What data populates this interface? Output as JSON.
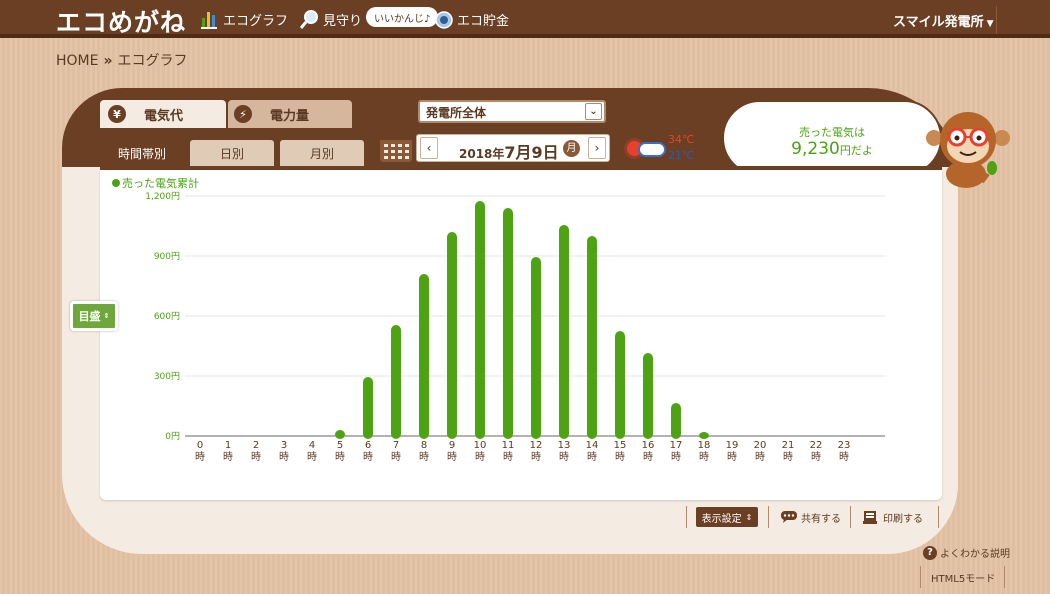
{
  "header": {
    "logo": "エコめがね",
    "nav": [
      {
        "label": "エコグラフ",
        "icon": "bar-chart-icon"
      },
      {
        "label": "見守り",
        "icon": "magnifier-icon"
      },
      {
        "label": "エコ貯金",
        "icon": "coin-icon"
      }
    ],
    "bubble": "いいかんじ♪",
    "user_menu": "スマイル発電所"
  },
  "breadcrumb": {
    "home": "HOME",
    "separator": "»",
    "current": "エコグラフ"
  },
  "tabs": [
    {
      "label": "電気代",
      "icon_glyph": "¥",
      "active": true
    },
    {
      "label": "電力量",
      "icon_glyph": "⚡",
      "active": false
    }
  ],
  "plant_select": {
    "value": "発電所全体"
  },
  "period_tabs": [
    {
      "label": "時間帯別",
      "active": true
    },
    {
      "label": "日別",
      "active": false
    },
    {
      "label": "月別",
      "active": false
    }
  ],
  "date": {
    "year": "2018年",
    "main": "7月9日",
    "weekday": "月",
    "prev": "‹",
    "next": "›"
  },
  "weather": {
    "high": "34℃",
    "low": "21℃"
  },
  "speech": {
    "line1": "売った電気は",
    "amount": "9,230",
    "unit": "円だよ"
  },
  "scale_button": {
    "label": "目盛"
  },
  "bottom": {
    "display_settings": "表示設定",
    "share": "共有する",
    "print": "印刷する",
    "help": "よくわかる説明",
    "html5": "HTML5モード"
  },
  "colors": {
    "brown": "#6b3f23",
    "bar": "#4ea312",
    "accent_green": "#4aa312"
  },
  "chart_data": {
    "type": "bar",
    "legend": "売った電気累計",
    "categories": [
      "0",
      "1",
      "2",
      "3",
      "4",
      "5",
      "6",
      "7",
      "8",
      "9",
      "10",
      "11",
      "12",
      "13",
      "14",
      "15",
      "16",
      "17",
      "18",
      "19",
      "20",
      "21",
      "22",
      "23"
    ],
    "category_suffix": "時",
    "values": [
      0,
      0,
      0,
      0,
      0,
      30,
      295,
      555,
      810,
      1020,
      1175,
      1140,
      895,
      1055,
      1000,
      525,
      415,
      165,
      8,
      0,
      0,
      0,
      0,
      0
    ],
    "ylim": [
      0,
      1200
    ],
    "yticks": [
      {
        "value": 0,
        "label": "0円"
      },
      {
        "value": 300,
        "label": "300円"
      },
      {
        "value": 600,
        "label": "600円"
      },
      {
        "value": 900,
        "label": "900円"
      },
      {
        "value": 1200,
        "label": "1,200円"
      }
    ],
    "grid": true
  }
}
